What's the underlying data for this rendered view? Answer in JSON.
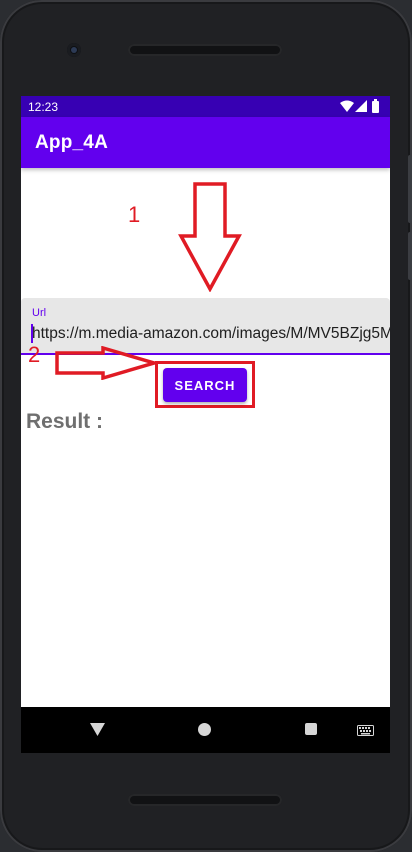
{
  "status_bar": {
    "time": "12:23",
    "icons": [
      "wifi-icon",
      "signal-icon",
      "battery-icon"
    ]
  },
  "app_bar": {
    "title": "App_4A"
  },
  "annotations": {
    "step1": "1",
    "step2": "2",
    "color": "#e01b24"
  },
  "url_field": {
    "label": "Url",
    "value": "https://m.media-amazon.com/images/M/MV5BZjg5M"
  },
  "search_button": {
    "label": "SEARCH"
  },
  "result": {
    "label": "Result :"
  },
  "nav_bar": {
    "icons": [
      "back-icon",
      "home-icon",
      "recents-icon",
      "keyboard-icon"
    ]
  },
  "colors": {
    "primary": "#6200ee",
    "primary_dark": "#3700b3",
    "annotation": "#e01b24"
  }
}
